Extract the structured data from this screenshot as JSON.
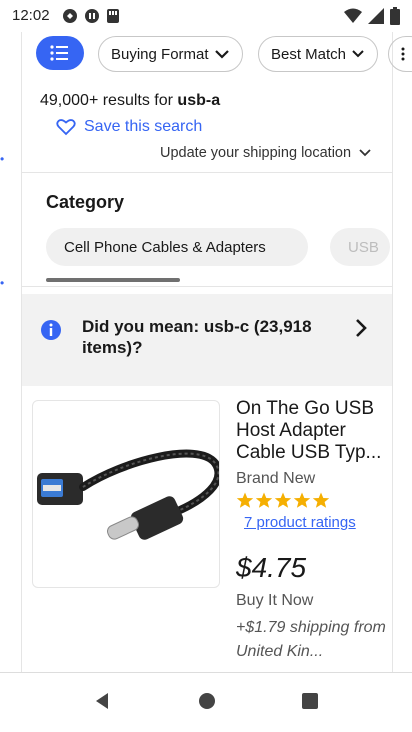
{
  "status_bar": {
    "time": "12:02",
    "left_icons": [
      "notification-icon",
      "media-icon",
      "storage-icon"
    ],
    "right_icons": [
      "wifi-icon",
      "signal-icon",
      "battery-icon"
    ]
  },
  "toolbar": {
    "menu_icon": "hamburger-menu-icon",
    "buying_format_label": "Buying Format",
    "sort_label": "Best Match",
    "more_icon": "filter-list-icon"
  },
  "results": {
    "count": "49,000+",
    "mid_text": " results for ",
    "query": "usb-a",
    "save_search_label": "Save this search",
    "shipping_location_label": "Update your shipping location"
  },
  "category": {
    "title": "Category",
    "chips": [
      "Cell Phone Cables & Adapters",
      "USB"
    ]
  },
  "suggestion": {
    "text": "Did you mean: usb-c (23,918 items)?"
  },
  "product": {
    "title": "On The Go USB Host Adapter Cable USB Typ...",
    "condition": "Brand New",
    "rating_stars": 5,
    "ratings_label": "7 product ratings",
    "price": "$4.75",
    "buy_format": "Buy It Now",
    "shipping": "+$1.79 shipping from United Kin..."
  },
  "colors": {
    "accent": "#3665f3",
    "star": "#f5af02"
  }
}
